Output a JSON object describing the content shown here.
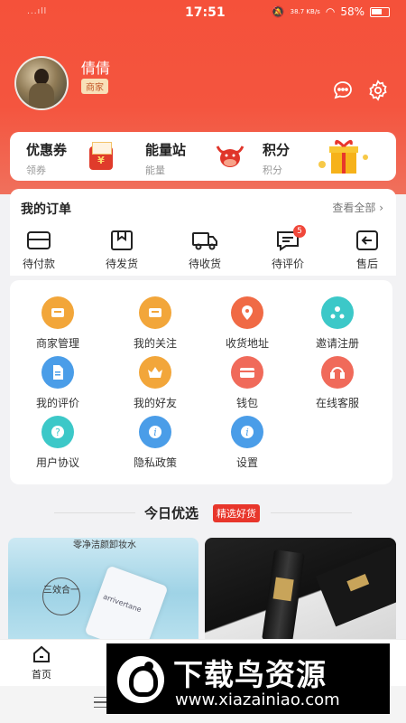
{
  "status_bar": {
    "time": "17:51",
    "network": "38.7 KB/s",
    "battery": "58%",
    "signal": "...ıll"
  },
  "profile": {
    "name": "倩倩",
    "role": "商家"
  },
  "promos": [
    {
      "title": "优惠券",
      "subtitle": "领券",
      "icon": "coupon-icon"
    },
    {
      "title": "能量站",
      "subtitle": "能量",
      "icon": "bull-icon"
    },
    {
      "title": "积分",
      "subtitle": "积分",
      "icon": "gift-icon"
    }
  ],
  "coupon_glyph": "¥",
  "orders": {
    "title": "我的订单",
    "view_all": "查看全部 ›",
    "items": [
      {
        "label": "待付款",
        "icon": "wallet-icon"
      },
      {
        "label": "待发货",
        "icon": "package-icon"
      },
      {
        "label": "待收货",
        "icon": "truck-icon"
      },
      {
        "label": "待评价",
        "icon": "comment-icon",
        "badge": "5"
      },
      {
        "label": "售后",
        "icon": "return-icon"
      }
    ]
  },
  "services": [
    {
      "label": "商家管理",
      "icon": "store-icon",
      "color": "#f2a63a"
    },
    {
      "label": "我的关注",
      "icon": "follow-icon",
      "color": "#f2a63a"
    },
    {
      "label": "收货地址",
      "icon": "location-icon",
      "color": "#f06a45"
    },
    {
      "label": "邀请注册",
      "icon": "invite-icon",
      "color": "#3cc8c8"
    },
    {
      "label": "我的评价",
      "icon": "review-icon",
      "color": "#4a9de8"
    },
    {
      "label": "我的好友",
      "icon": "friends-icon",
      "color": "#f2a63a"
    },
    {
      "label": "钱包",
      "icon": "wallet-card-icon",
      "color": "#f06a5a"
    },
    {
      "label": "在线客服",
      "icon": "support-icon",
      "color": "#f06a5a"
    },
    {
      "label": "用户协议",
      "icon": "help-icon",
      "color": "#3cc8c8"
    },
    {
      "label": "隐私政策",
      "icon": "info-icon",
      "color": "#4a9de8"
    },
    {
      "label": "设置",
      "icon": "settings-info-icon",
      "color": "#4a9de8"
    }
  ],
  "today": {
    "title": "今日优选",
    "tag": "精选好货"
  },
  "products": [
    {
      "caption": "零净洁颜卸妆水",
      "badge": "三效合一",
      "brand": "arrivertane"
    },
    {
      "caption": ""
    }
  ],
  "tabbar": {
    "home": "首页"
  },
  "watermark": {
    "title": "下载鸟资源",
    "url": "www.xiazainiao.com"
  }
}
